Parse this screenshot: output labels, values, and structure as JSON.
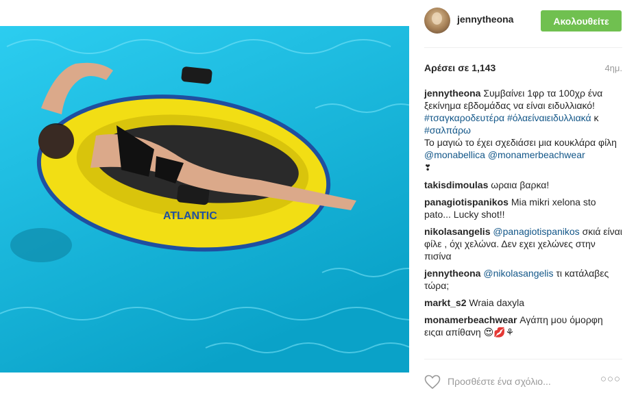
{
  "post": {
    "username": "jennytheona",
    "follow_label": "Ακολουθείτε",
    "likes_label": "Αρέσει σε 1,143",
    "time_ago": "4ημ.",
    "photo_boat_text": "ATLANTIC",
    "caption": {
      "user": "jennytheona",
      "text1": "Συμβαίνει 1φρ τα 100χρ ένα ξεκίνημα εβδομάδας να είναι ειδυλλιακό!",
      "hashtag1": "#τσαγκαροδευτέρα",
      "hashtag2": "#όλαείναιειδυλλιακά",
      "connector": "κ",
      "hashtag3": "#σαλπάρω",
      "text2": "Το μαγιώ το έχει σχεδιάσει μια κουκλάρα φίλη",
      "mention1": "@monabellica",
      "mention2": "@monamerbeachwear",
      "trailing_emoji": "❣"
    },
    "comments": [
      {
        "user": "takisdimoulas",
        "text": "ωραια βαρκα!"
      },
      {
        "user": "panagiotispanikos",
        "text": "Mia mikri xelona sto pato... Lucky shot!!"
      },
      {
        "user": "nikolasangelis",
        "mention": "@panagiotispanikos",
        "text": "σκιά είναι φίλε , όχι χελώνα. Δεν εχει χελώνες στην πισίνα"
      },
      {
        "user": "jennytheona",
        "mention": "@nikolasangelis",
        "text": "τι κατάλαβες τώρα;"
      },
      {
        "user": "markt_s2",
        "text": "Wraia daxyla"
      },
      {
        "user": "monamerbeachwear",
        "text": "Αγάπη μου όμορφη ειςαι απίθανη 😍💋⚘"
      }
    ],
    "comment_placeholder": "Προσθέστε ένα σχόλιο...",
    "more_label": "○○○"
  },
  "colors": {
    "follow_button": "#70c050",
    "link": "#125688",
    "muted": "#999999",
    "pool": "#13b9d8",
    "boat": "#f2de14"
  },
  "icons": {
    "like": "heart-outline-icon",
    "avatar": "profile-photo"
  }
}
